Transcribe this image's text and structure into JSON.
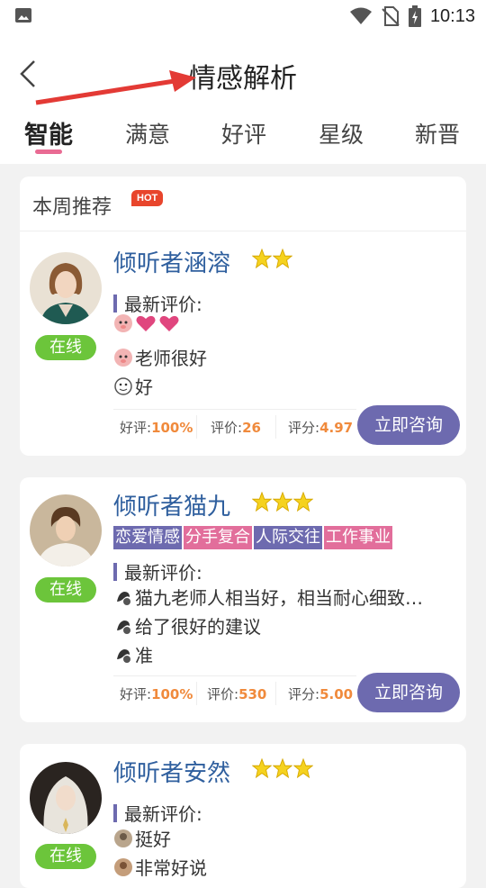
{
  "status_bar": {
    "time": "10:13"
  },
  "header": {
    "title": "情感解析"
  },
  "tabs": [
    {
      "label": "智能",
      "active": true
    },
    {
      "label": "满意"
    },
    {
      "label": "好评"
    },
    {
      "label": "星级"
    },
    {
      "label": "新晋"
    }
  ],
  "weekly": {
    "title": "本周推荐",
    "hot_badge": "HOT"
  },
  "counselors": [
    {
      "name": "倾听者涵溶",
      "status": "在线",
      "stars": 2,
      "latest_label": "最新评价:",
      "reviews": [
        "",
        "老师很好",
        "好"
      ],
      "stats": {
        "good_label": "好评:",
        "good_value": "100%",
        "review_label": "评价:",
        "review_value": "26",
        "score_label": "评分:",
        "score_value": "4.97"
      },
      "button": "立即咨询"
    },
    {
      "name": "倾听者猫九",
      "status": "在线",
      "stars": 3,
      "tags": [
        "恋爱情感",
        "分手复合",
        "人际交往",
        "工作事业"
      ],
      "latest_label": "最新评价:",
      "reviews": [
        "猫九老师人相当好，相当耐心细致…",
        "给了很好的建议",
        "准"
      ],
      "stats": {
        "good_label": "好评:",
        "good_value": "100%",
        "review_label": "评价:",
        "review_value": "530",
        "score_label": "评分:",
        "score_value": "5.00"
      },
      "button": "立即咨询"
    },
    {
      "name": "倾听者安然",
      "status": "在线",
      "stars": 3,
      "latest_label": "最新评价:",
      "reviews": [
        "挺好",
        "非常好说"
      ]
    }
  ],
  "colors": {
    "accent": "#6d6aaf",
    "tab_indicator": "#e96b93",
    "online": "#6cc53b",
    "name": "#2f5f9e",
    "stat_value": "#f08a3c",
    "hot": "#e8452c"
  }
}
